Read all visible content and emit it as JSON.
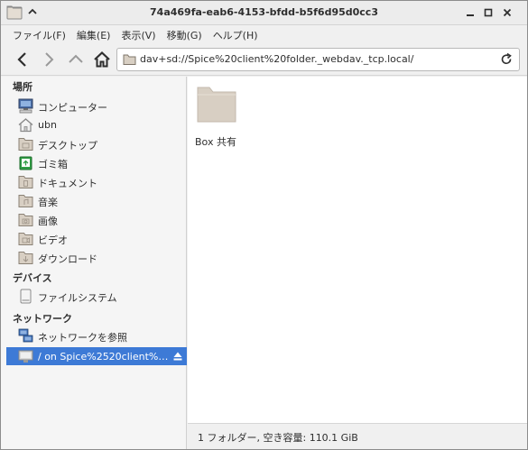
{
  "window": {
    "title": "74a469fa-eab6-4153-bfdd-b5f6d95d0cc3"
  },
  "menubar": {
    "items": [
      "ファイル(F)",
      "編集(E)",
      "表示(V)",
      "移動(G)",
      "ヘルプ(H)"
    ]
  },
  "toolbar": {
    "location": "dav+sd://Spice%20client%20folder._webdav._tcp.local/"
  },
  "sidebar": {
    "places_header": "場所",
    "places": [
      {
        "label": "コンピューター",
        "icon": "computer-icon"
      },
      {
        "label": "ubn",
        "icon": "home-icon"
      },
      {
        "label": "デスクトップ",
        "icon": "desktop-folder-icon"
      },
      {
        "label": "ゴミ箱",
        "icon": "trash-icon"
      },
      {
        "label": "ドキュメント",
        "icon": "documents-folder-icon"
      },
      {
        "label": "音楽",
        "icon": "music-folder-icon"
      },
      {
        "label": "画像",
        "icon": "pictures-folder-icon"
      },
      {
        "label": "ビデオ",
        "icon": "videos-folder-icon"
      },
      {
        "label": "ダウンロード",
        "icon": "downloads-folder-icon"
      }
    ],
    "devices_header": "デバイス",
    "devices": [
      {
        "label": "ファイルシステム",
        "icon": "drive-icon"
      }
    ],
    "network_header": "ネットワーク",
    "network": [
      {
        "label": "ネットワークを参照",
        "icon": "network-icon"
      },
      {
        "label": "/ on Spice%2520client%2…",
        "icon": "network-share-icon",
        "selected": true
      }
    ]
  },
  "main": {
    "items": [
      {
        "name": "Box 共有",
        "icon": "folder-icon"
      }
    ]
  },
  "statusbar": {
    "text": "1 フォルダー, 空き容量: 110.1 GiB"
  },
  "colors": {
    "selection": "#3d7ad6",
    "folder": "#d8cfc3"
  }
}
